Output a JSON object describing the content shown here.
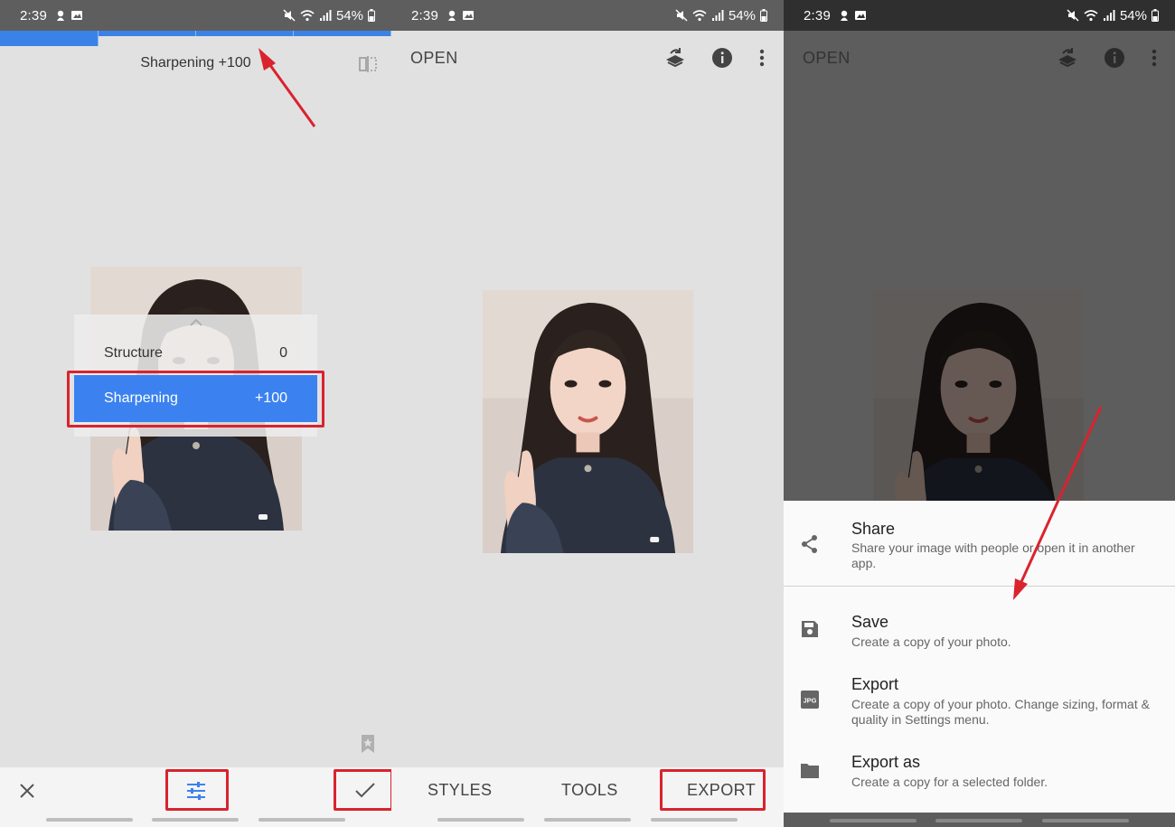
{
  "status": {
    "time": "2:39",
    "battery": "54%"
  },
  "editor": {
    "header_title": "Sharpening +100",
    "menu": [
      {
        "label": "Structure",
        "value": "0"
      },
      {
        "label": "Sharpening",
        "value": "+100"
      }
    ],
    "tab_count": 4
  },
  "home": {
    "open_label": "OPEN",
    "tabs": {
      "styles": "STYLES",
      "tools": "TOOLS",
      "export": "EXPORT"
    }
  },
  "export_menu": {
    "open_label": "OPEN",
    "items": [
      {
        "title": "Share",
        "desc": "Share your image with people or open it in another app.",
        "icon": "share-icon"
      },
      {
        "title": "Save",
        "desc": "Create a copy of your photo.",
        "icon": "save-icon"
      },
      {
        "title": "Export",
        "desc": "Create a copy of your photo. Change sizing, format & quality in Settings menu.",
        "icon": "jpg-file-icon"
      },
      {
        "title": "Export as",
        "desc": "Create a copy for a selected folder.",
        "icon": "folder-icon"
      }
    ],
    "jpg_badge": "JPG"
  },
  "colors": {
    "accent": "#3b82f0",
    "highlight_red": "#d9232e"
  }
}
